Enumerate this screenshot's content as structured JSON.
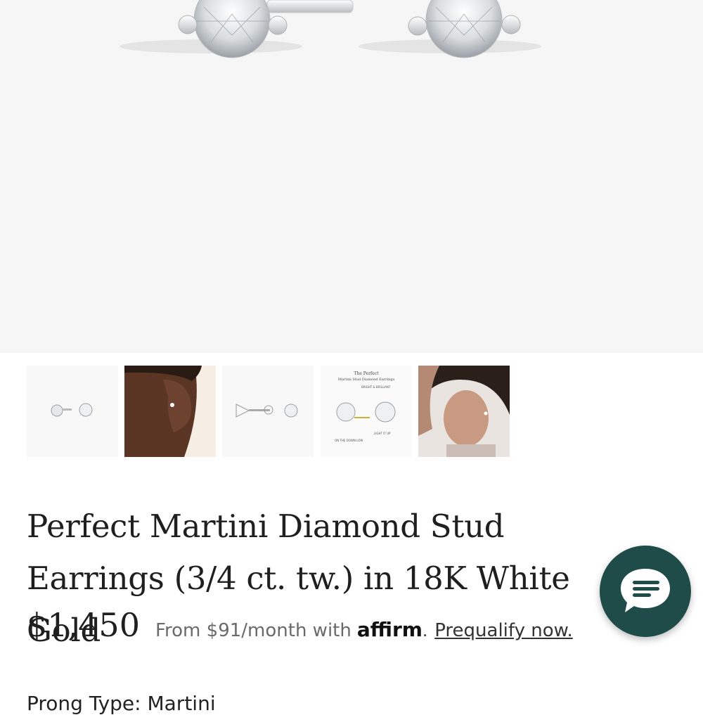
{
  "hero": {
    "image": "diamond-stud-earrings-main-image"
  },
  "gallery": {
    "selected_index": 0,
    "thumbnails": [
      {
        "name": "earrings-front-view-thumbnail"
      },
      {
        "name": "earring-on-ear-thumbnail"
      },
      {
        "name": "earring-side-profile-thumbnail"
      },
      {
        "name": "earrings-info-graphic-thumbnail",
        "heading_line1": "The Perfect",
        "heading_line2": "Martini Stud Diamond Earrings",
        "callout1": "BRIGHT & BRILLIANT",
        "callout2": "ON THE DOWN LOW",
        "callout3": "LIGHT IT UP"
      },
      {
        "name": "model-wearing-earrings-thumbnail"
      }
    ]
  },
  "product": {
    "title": "Perfect Martini Diamond Stud Earrings (3/4 ct. tw.) in 18K White Gold",
    "price": "$1,450",
    "financing_text": "From $91/month with",
    "affirm_logo": "affirm",
    "affirm_period": ".",
    "prequalify_link": "Prequalify now.",
    "prong_type": "Prong Type: Martini"
  },
  "chat": {
    "icon": "chat-bubble-icon"
  },
  "colors": {
    "accent": "#0f5b56",
    "chat": "#1f4b49",
    "hero_bg": "#f6f6f6"
  }
}
